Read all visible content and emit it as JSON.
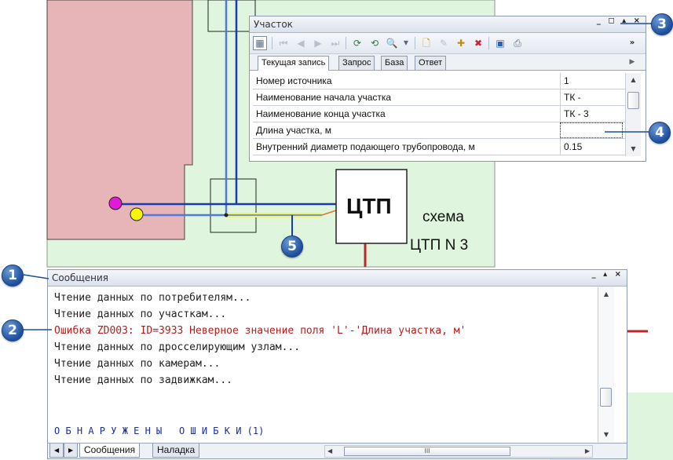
{
  "map": {
    "ctp_label": "ЦТП",
    "scheme_line1": "схема",
    "scheme_line2": "ЦТП N 3",
    "colors": {
      "pink_zone": "#e7b4b8",
      "green_zone": "#dff5de",
      "pipe_blue": "#1a3ab0",
      "pipe_light": "#4f78e0",
      "highlight": "#f4f26a",
      "error_red": "#c0272d"
    }
  },
  "uchastok": {
    "title": "Участок",
    "window_buttons": "_ ◻ ▴ ×",
    "toolbar_icons": [
      "table-icon",
      "first-record-icon",
      "prev-record-icon",
      "next-record-icon",
      "last-record-icon",
      "refresh-query-icon",
      "refresh-icon",
      "search-icon",
      "dropdown-icon",
      "new-record-icon",
      "edit-record-icon",
      "add-record-icon",
      "delete-record-icon",
      "save-icon",
      "print-icon",
      "overflow-icon"
    ],
    "tabs": [
      "Текущая запись",
      "Запрос",
      "База",
      "Ответ"
    ],
    "rows": [
      {
        "name": "Номер источника",
        "value": "1"
      },
      {
        "name": "Наименование начала участка",
        "value": "ТК -"
      },
      {
        "name": "Наименование конца участка",
        "value": "ТК - 3"
      },
      {
        "name": "Длина участка, м",
        "value": ""
      },
      {
        "name": "Внутренний диаметр подающего трубопровода, м",
        "value": "0.15"
      }
    ]
  },
  "messages": {
    "title": "Сообщения",
    "window_buttons": "_ ▴ ×",
    "lines": [
      {
        "text": "Чтение данных по потребителям...",
        "type": "info"
      },
      {
        "text": "Чтение данных по участкам...",
        "type": "info"
      },
      {
        "text": "Ошибка ZD003: ID=3933 Неверное значение поля 'L'-'Длина участка, м'",
        "type": "error"
      },
      {
        "text": "Чтение данных по дросселирующим узлам...",
        "type": "info"
      },
      {
        "text": "Чтение данных по камерам...",
        "type": "info"
      },
      {
        "text": "Чтение данных по задвижкам...",
        "type": "info"
      }
    ],
    "summary": "О Б Н А Р У Ж Е Н Ы   О Ш И Б К И (1)",
    "bottom_tabs": [
      "Сообщения",
      "Наладка"
    ],
    "scroll_mark": "III"
  },
  "callouts": [
    "1",
    "2",
    "3",
    "4",
    "5"
  ]
}
